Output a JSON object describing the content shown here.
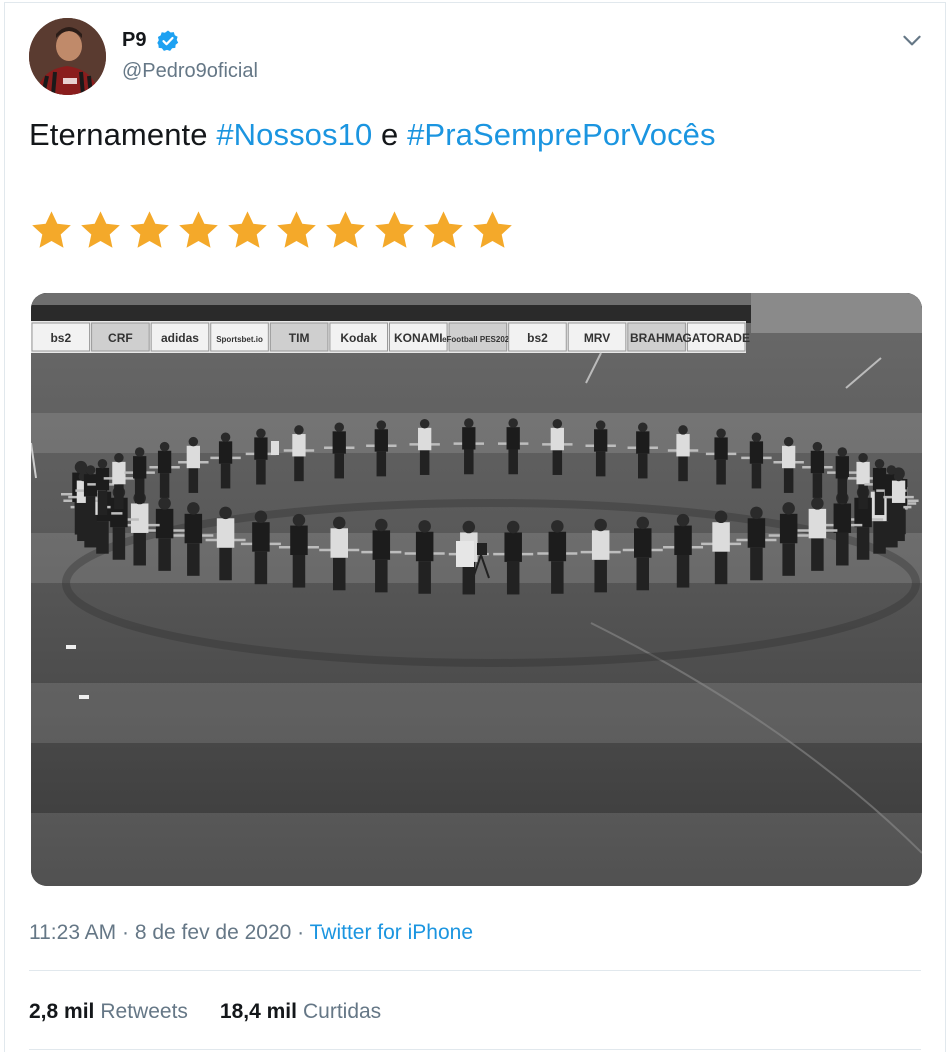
{
  "author": {
    "display_name": "P9",
    "handle": "@Pedro9oficial",
    "verified": true,
    "avatar_icon": "player-avatar"
  },
  "tweet": {
    "text_prefix": "Eternamente ",
    "hashtag_1": "#Nossos10",
    "text_mid": " e ",
    "hashtag_2": "#PraSemprePorVocês",
    "stars": [
      "★",
      "★",
      "★",
      "★",
      "★",
      "★",
      "★",
      "★",
      "★",
      "★"
    ],
    "star_color": "#f4a92a"
  },
  "photo": {
    "ad_boards": [
      "bs2",
      "CRF",
      "adidas",
      "Sportsbet.io",
      "TIM",
      "Kodak",
      "KONAMI",
      "eFootball PES2020",
      "bs2",
      "MRV",
      "BRAHMA",
      "GATORADE"
    ]
  },
  "meta": {
    "time": "11:23 AM",
    "separator": " · ",
    "date": "8 de fev de 2020",
    "source": "Twitter for iPhone"
  },
  "stats": {
    "retweets_count": "2,8 mil",
    "retweets_label": "Retweets",
    "likes_count": "18,4 mil",
    "likes_label": "Curtidas"
  },
  "colors": {
    "link": "#1b95e0",
    "secondary_text": "#657786",
    "verified": "#1da1f2"
  }
}
